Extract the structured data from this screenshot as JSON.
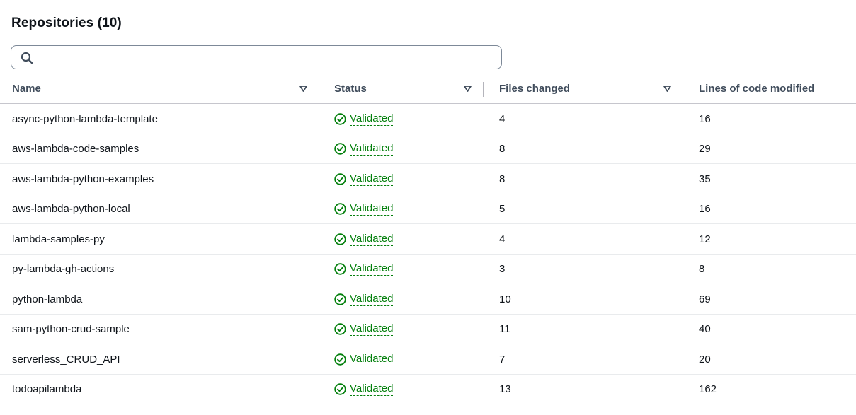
{
  "header": {
    "title": "Repositories (10)"
  },
  "search": {
    "placeholder": "",
    "value": "",
    "icon": "search-icon"
  },
  "table": {
    "columns": [
      {
        "key": "name",
        "label": "Name",
        "sortable": true
      },
      {
        "key": "status",
        "label": "Status",
        "sortable": true
      },
      {
        "key": "files_changed",
        "label": "Files changed",
        "sortable": true
      },
      {
        "key": "lines_modified",
        "label": "Lines of code modified",
        "sortable": false
      }
    ],
    "rows": [
      {
        "name": "async-python-lambda-template",
        "status": "Validated",
        "files_changed": "4",
        "lines_modified": "16"
      },
      {
        "name": "aws-lambda-code-samples",
        "status": "Validated",
        "files_changed": "8",
        "lines_modified": "29"
      },
      {
        "name": "aws-lambda-python-examples",
        "status": "Validated",
        "files_changed": "8",
        "lines_modified": "35"
      },
      {
        "name": "aws-lambda-python-local",
        "status": "Validated",
        "files_changed": "5",
        "lines_modified": "16"
      },
      {
        "name": "lambda-samples-py",
        "status": "Validated",
        "files_changed": "4",
        "lines_modified": "12"
      },
      {
        "name": "py-lambda-gh-actions",
        "status": "Validated",
        "files_changed": "3",
        "lines_modified": "8"
      },
      {
        "name": "python-lambda",
        "status": "Validated",
        "files_changed": "10",
        "lines_modified": "69"
      },
      {
        "name": "sam-python-crud-sample",
        "status": "Validated",
        "files_changed": "11",
        "lines_modified": "40"
      },
      {
        "name": "serverless_CRUD_API",
        "status": "Validated",
        "files_changed": "7",
        "lines_modified": "20"
      },
      {
        "name": "todoapilambda",
        "status": "Validated",
        "files_changed": "13",
        "lines_modified": "162"
      }
    ]
  },
  "colors": {
    "status_success": "#037f0c",
    "header_text": "#414d5c",
    "divider": "#c6c6cd"
  }
}
